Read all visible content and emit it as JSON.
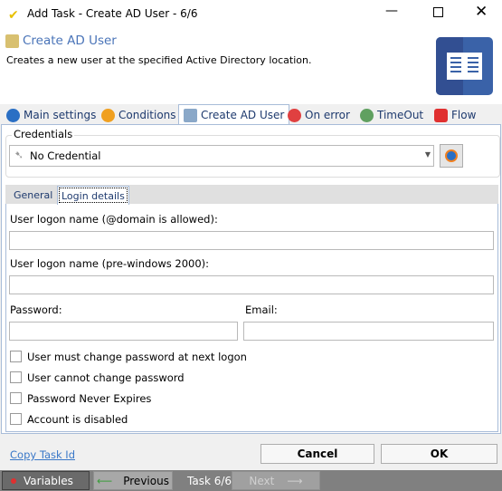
{
  "window": {
    "title": "Add Task - Create AD User - 6/6"
  },
  "header": {
    "title": "Create AD User",
    "description": "Creates a new user at the specified Active Directory location."
  },
  "tabs": [
    {
      "label": "Main settings",
      "icon": "gear-icon",
      "color": "#2a6fc4"
    },
    {
      "label": "Conditions",
      "icon": "question-icon",
      "color": "#f0a020"
    },
    {
      "label": "Create AD User",
      "icon": "ad-user-icon",
      "color": "#5a8ac0",
      "active": true
    },
    {
      "label": "On error",
      "icon": "error-icon",
      "color": "#e04040"
    },
    {
      "label": "TimeOut",
      "icon": "timeout-icon",
      "color": "#60a060"
    },
    {
      "label": "Flow",
      "icon": "flow-icon",
      "color": "#e03030"
    }
  ],
  "credentials": {
    "legend": "Credentials",
    "selected": "No Credential"
  },
  "subtabs": [
    {
      "label": "General"
    },
    {
      "label": "Login details",
      "active": true
    }
  ],
  "form": {
    "logon_label": "User logon name (@domain is allowed):",
    "logon_value": "",
    "pre2000_label": "User logon name (pre-windows 2000):",
    "pre2000_value": "",
    "password_label": "Password:",
    "password_value": "",
    "email_label": "Email:",
    "email_value": "",
    "checkboxes": [
      {
        "label": "User must change password at next logon",
        "checked": false
      },
      {
        "label": "User cannot change password",
        "checked": false
      },
      {
        "label": "Password Never Expires",
        "checked": false
      },
      {
        "label": "Account is disabled",
        "checked": false
      }
    ]
  },
  "footer": {
    "copy_link": "Copy Task Id",
    "cancel": "Cancel",
    "ok": "OK"
  },
  "statusbar": {
    "variables": "Variables",
    "previous": "Previous",
    "task_counter": "Task 6/6",
    "next": "Next"
  }
}
